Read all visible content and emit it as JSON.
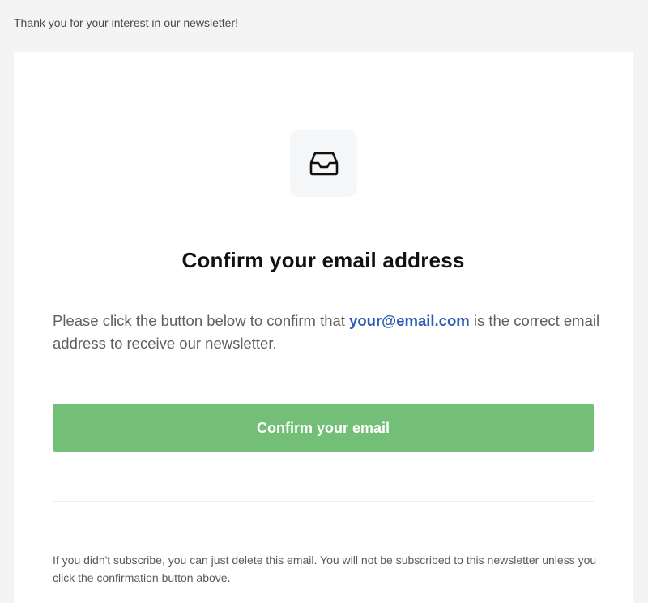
{
  "preheader": "Thank you for your interest in our newsletter!",
  "icon": "inbox-icon",
  "title": "Confirm your email address",
  "body": {
    "before": "Please click the button below to confirm that ",
    "email": "your@email.com",
    "after": " is the correct email address to receive our newsletter."
  },
  "button": {
    "label": "Confirm your email",
    "color": "#74bf78"
  },
  "footer": "If you didn't subscribe, you can just delete this email. You will not be subscribed to this newsletter unless you click the confirmation button above.",
  "colors": {
    "link": "#2d5bb5",
    "background": "#f4f4f4",
    "card": "#ffffff"
  }
}
